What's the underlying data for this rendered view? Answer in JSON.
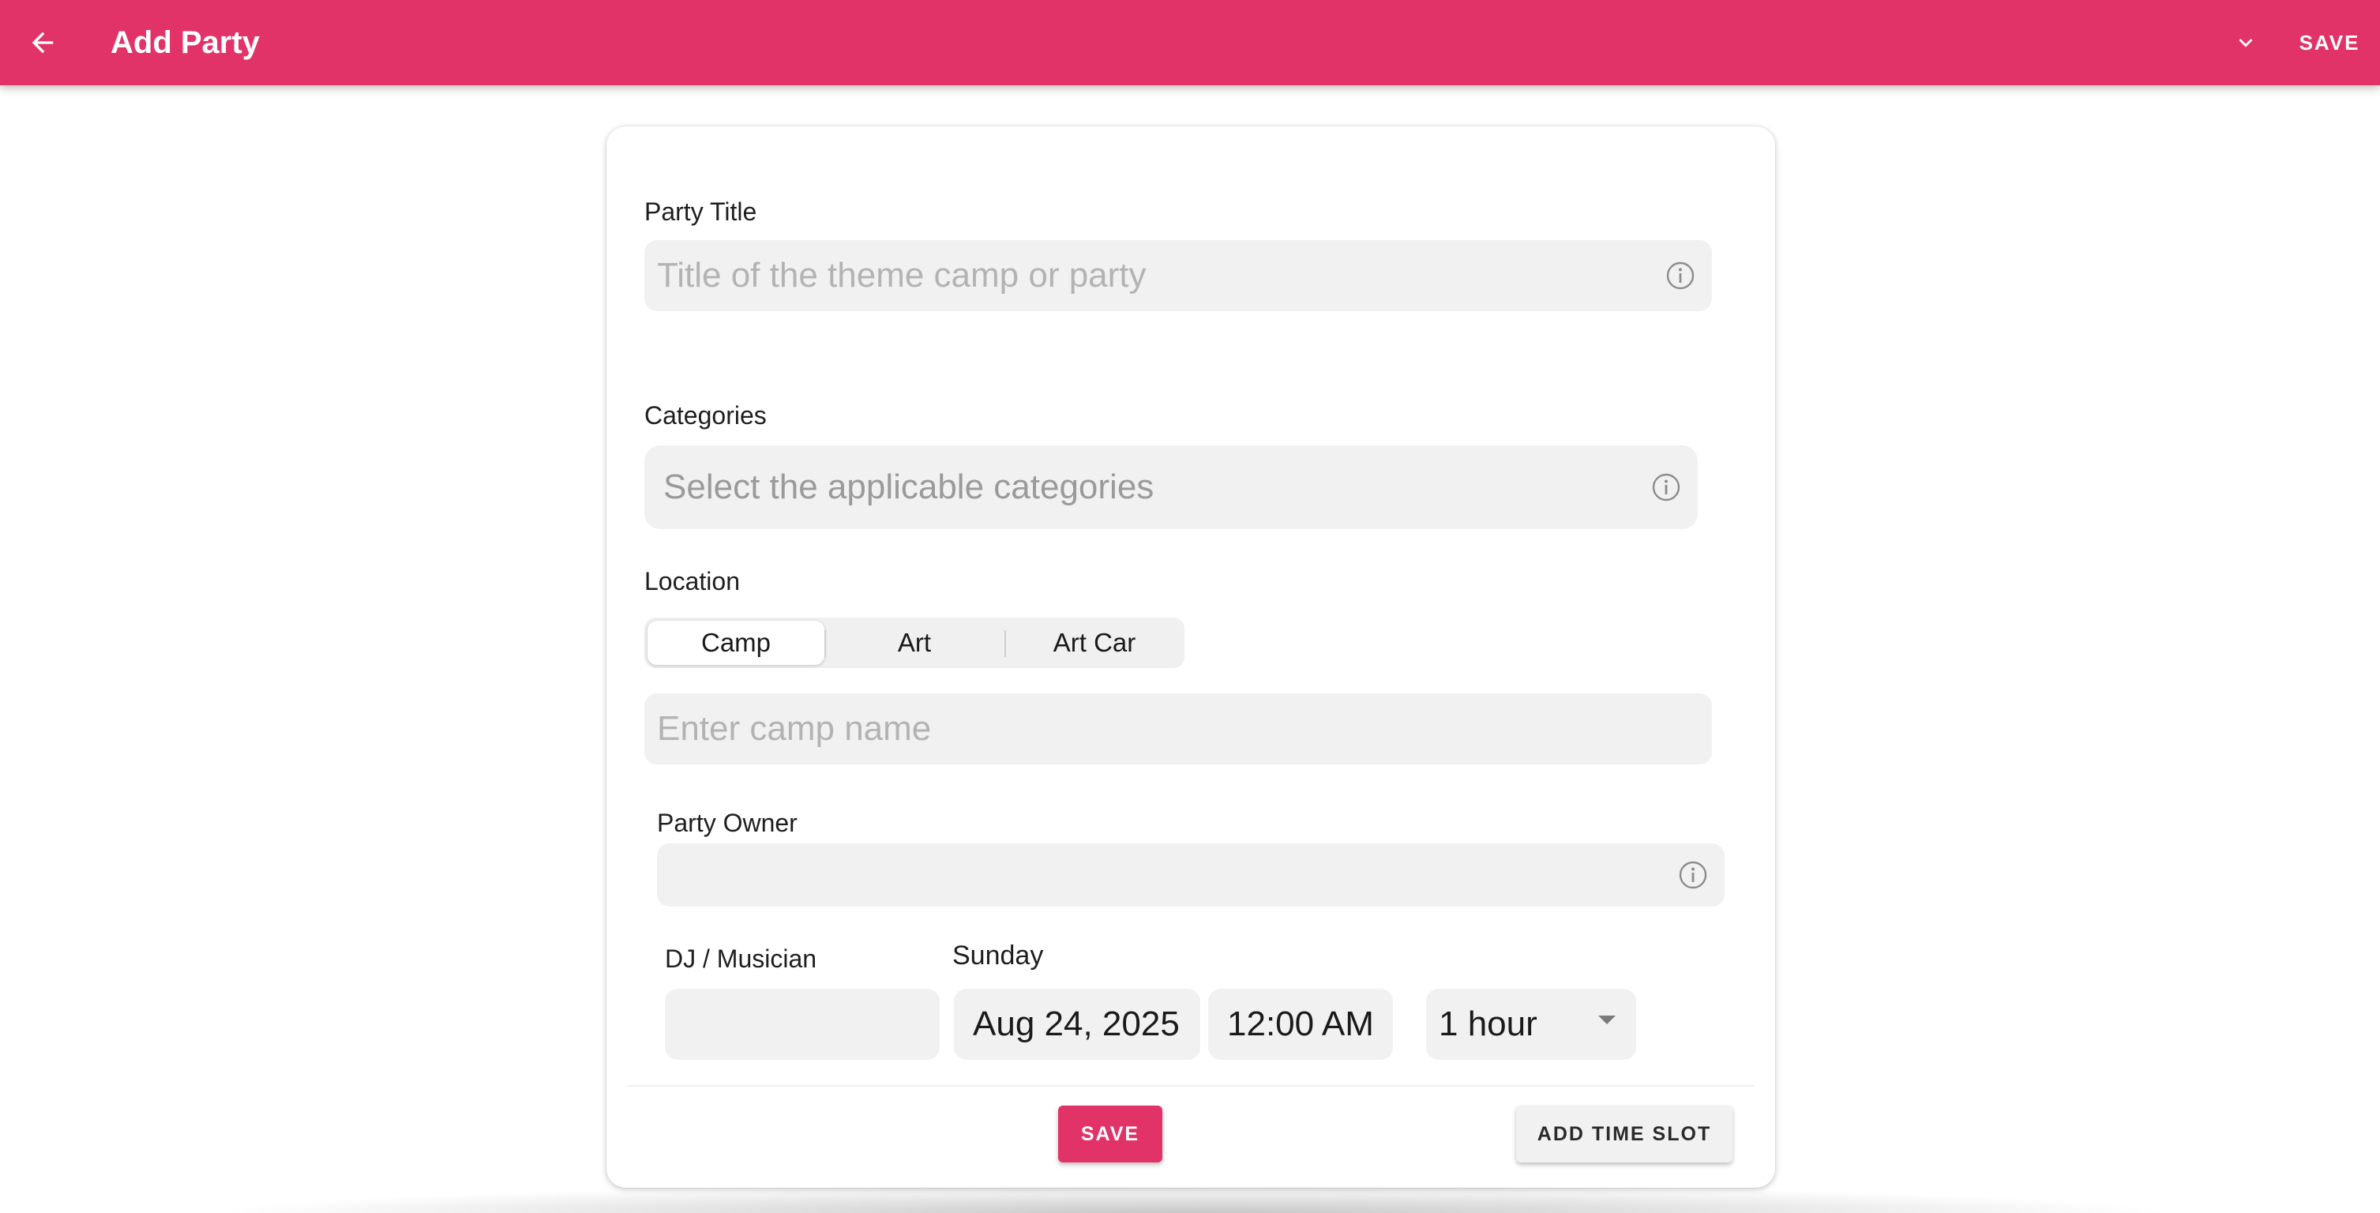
{
  "header": {
    "title": "Add Party",
    "back_icon": "arrow-left-icon",
    "menu_icon": "chevron-down-icon",
    "save_label": "SAVE",
    "bar_color": "#e23368"
  },
  "form": {
    "party_title": {
      "label": "Party Title",
      "placeholder": "Title of the theme camp or party",
      "value": ""
    },
    "categories": {
      "label": "Categories",
      "placeholder": "Select the applicable categories"
    },
    "location": {
      "label": "Location",
      "options": [
        "Camp",
        "Art",
        "Art Car"
      ],
      "selected": "Camp",
      "camp_placeholder": "Enter camp name"
    },
    "party_owner": {
      "label": "Party Owner",
      "value": ""
    },
    "time_slot": {
      "dj_label": "DJ / Musician",
      "dj_value": "",
      "day_label": "Sunday",
      "date": "Aug 24, 2025",
      "time": "12:00 AM",
      "duration": "1 hour"
    },
    "save_label": "SAVE",
    "add_time_slot_label": "ADD TIME SLOT"
  }
}
